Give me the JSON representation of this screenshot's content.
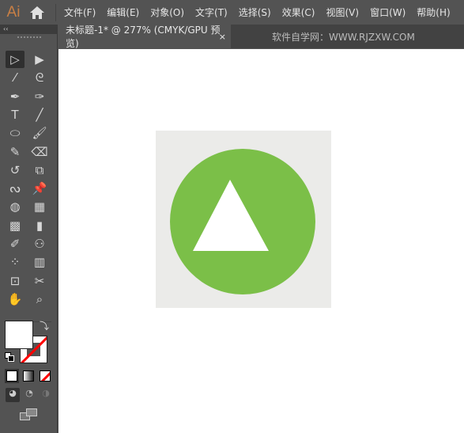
{
  "app": {
    "logo": "Ai",
    "home_icon": "home-icon"
  },
  "menu": [
    "文件(F)",
    "编辑(E)",
    "对象(O)",
    "文字(T)",
    "选择(S)",
    "效果(C)",
    "视图(V)",
    "窗口(W)",
    "帮助(H)"
  ],
  "panel": {
    "collapse_label": "‹‹"
  },
  "tabs": [
    {
      "label": "未标题-1* @ 277% (CMYK/GPU 预览)",
      "close": "×"
    },
    {
      "label": "软件自学网：WWW.RJZXW.COM"
    }
  ],
  "tools": [
    "selection",
    "direct-selection",
    "magic-wand",
    "lasso",
    "pen",
    "curvature",
    "type",
    "line-segment",
    "ellipse",
    "paintbrush",
    "shaper",
    "eraser",
    "rotate",
    "scale",
    "warp",
    "free-transform",
    "shape-builder",
    "perspective-grid",
    "mesh",
    "gradient",
    "eyedropper",
    "blend",
    "symbol-sprayer",
    "column-graph",
    "artboard",
    "slice",
    "hand",
    "zoom"
  ],
  "colors": {
    "shape_fill": "#7bbf48",
    "artboard": "#ebebe9",
    "triangle": "#ffffff",
    "fill_swatch": "#ffffff",
    "stroke_none": "#ff0000"
  }
}
